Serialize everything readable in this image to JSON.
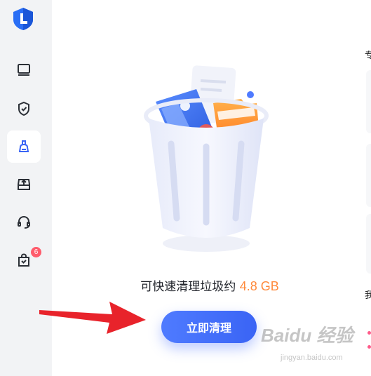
{
  "sidebar": {
    "badge_count": "6",
    "items": [
      {
        "icon": "monitor-icon"
      },
      {
        "icon": "shield-icon"
      },
      {
        "icon": "broom-icon"
      },
      {
        "icon": "upload-drive-icon"
      },
      {
        "icon": "headset-icon"
      },
      {
        "icon": "gift-bag-icon"
      }
    ]
  },
  "main": {
    "summary_prefix": "可快速清理垃圾约",
    "summary_size": "4.8 GB",
    "clean_button": "立即清理"
  },
  "right_panel": {
    "edge_text_1": "专",
    "edge_text_2": "我"
  },
  "watermark": {
    "title": "Baidu 经验",
    "subtitle": "jingyan.baidu.com"
  },
  "colors": {
    "accent": "#3a64f5",
    "size_highlight": "#ff8a3c",
    "badge": "#ff5b6b",
    "arrow": "#e8232b"
  }
}
